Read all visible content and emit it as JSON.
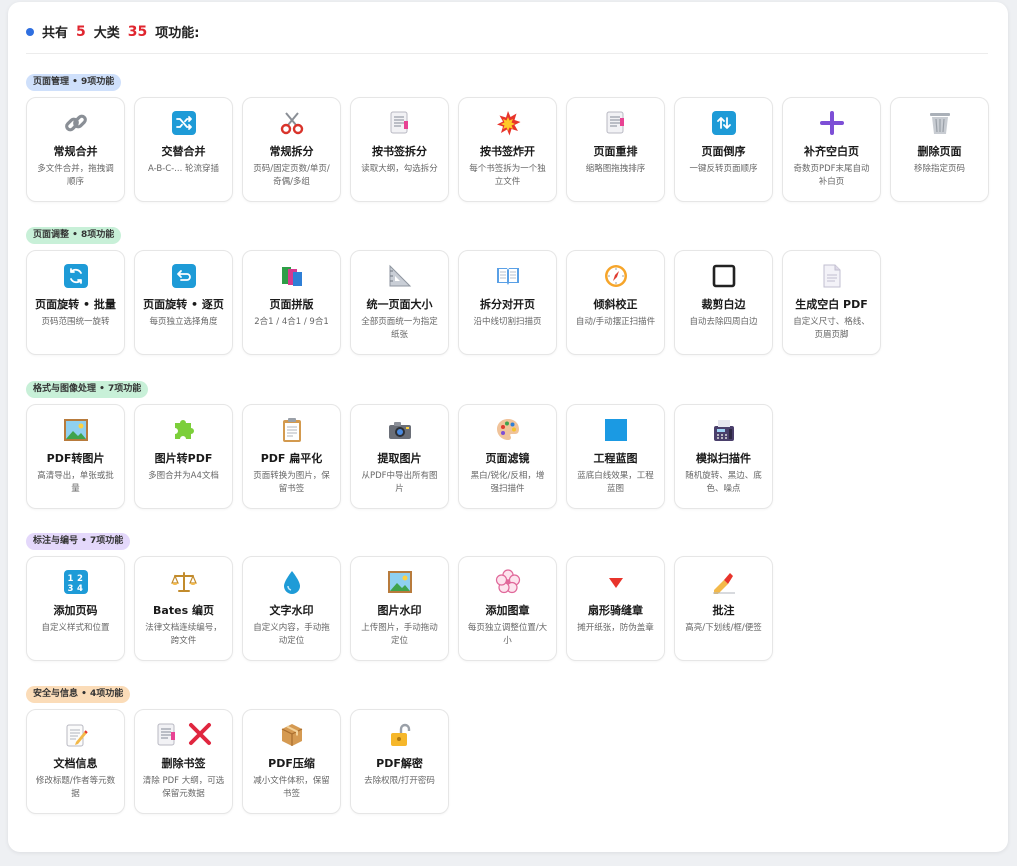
{
  "header": {
    "prefix": "共有",
    "big_count": "5",
    "mid": "大类",
    "func_count": "35",
    "suffix": "项功能:"
  },
  "sections": [
    {
      "badge": "页面管理 • 9项功能",
      "color": "#cfe0fb",
      "items": [
        {
          "title": "常规合并",
          "desc": "多文件合并，拖拽调顺序",
          "icon": "link-icon"
        },
        {
          "title": "交替合并",
          "desc": "A-B-C-... 轮流穿插",
          "icon": "shuffle-icon"
        },
        {
          "title": "常规拆分",
          "desc": "页码/固定页数/单页/奇偶/多组",
          "icon": "scissors-icon"
        },
        {
          "title": "按书签拆分",
          "desc": "读取大纲，勾选拆分",
          "icon": "bookmark-doc-icon"
        },
        {
          "title": "按书签炸开",
          "desc": "每个书签拆为一个独立文件",
          "icon": "explosion-icon"
        },
        {
          "title": "页面重排",
          "desc": "缩略图拖拽排序",
          "icon": "reorder-doc-icon"
        },
        {
          "title": "页面倒序",
          "desc": "一键反转页面顺序",
          "icon": "reverse-arrows-icon"
        },
        {
          "title": "补齐空白页",
          "desc": "奇数页PDF末尾自动补白页",
          "icon": "plus-icon"
        },
        {
          "title": "删除页面",
          "desc": "移除指定页码",
          "icon": "trash-icon"
        }
      ]
    },
    {
      "badge": "页面调整 • 8项功能",
      "color": "#c8f0d8",
      "items": [
        {
          "title": "页面旋转 • 批量",
          "desc": "页码范围统一旋转",
          "icon": "rotate-batch-icon"
        },
        {
          "title": "页面旋转 • 逐页",
          "desc": "每页独立选择角度",
          "icon": "rotate-page-icon"
        },
        {
          "title": "页面拼版",
          "desc": "2合1 / 4合1 / 9合1",
          "icon": "books-icon"
        },
        {
          "title": "统一页面大小",
          "desc": "全部页面统一为指定纸张",
          "icon": "triangle-ruler-icon"
        },
        {
          "title": "拆分对开页",
          "desc": "沿中线切割扫描页",
          "icon": "open-book-icon"
        },
        {
          "title": "倾斜校正",
          "desc": "自动/手动摆正扫描件",
          "icon": "compass-icon"
        },
        {
          "title": "裁剪白边",
          "desc": "自动去除四周白边",
          "icon": "crop-square-icon"
        },
        {
          "title": "生成空白 PDF",
          "desc": "自定义尺寸、格线、页眉页脚",
          "icon": "blank-doc-icon"
        }
      ]
    },
    {
      "badge": "格式与图像处理 • 7项功能",
      "color": "#c8f0d8",
      "items": [
        {
          "title": "PDF转图片",
          "desc": "高清导出，单张或批量",
          "icon": "picture-icon"
        },
        {
          "title": "图片转PDF",
          "desc": "多图合并为A4文档",
          "icon": "puzzle-icon"
        },
        {
          "title": "PDF 扁平化",
          "desc": "页面转换为图片，保留书签",
          "icon": "clipboard-icon"
        },
        {
          "title": "提取图片",
          "desc": "从PDF中导出所有图片",
          "icon": "camera-icon"
        },
        {
          "title": "页面滤镜",
          "desc": "黑白/锐化/反相，增强扫描件",
          "icon": "palette-icon"
        },
        {
          "title": "工程蓝图",
          "desc": "蓝底白线效果，工程蓝图",
          "icon": "blue-square-icon"
        },
        {
          "title": "模拟扫描件",
          "desc": "随机旋转、黑边、底色、噪点",
          "icon": "fax-icon"
        }
      ]
    },
    {
      "badge": "标注与编号 • 7项功能",
      "color": "#e4d8fb",
      "items": [
        {
          "title": "添加页码",
          "desc": "自定义样式和位置",
          "icon": "numbers-icon"
        },
        {
          "title": "Bates 编页",
          "desc": "法律文档连续编号，跨文件",
          "icon": "scales-icon"
        },
        {
          "title": "文字水印",
          "desc": "自定义内容，手动拖动定位",
          "icon": "droplet-icon"
        },
        {
          "title": "图片水印",
          "desc": "上传图片，手动拖动定位",
          "icon": "picture-frame-icon"
        },
        {
          "title": "添加图章",
          "desc": "每页独立调整位置/大小",
          "icon": "flower-stamp-icon"
        },
        {
          "title": "扇形骑缝章",
          "desc": "摊开纸张，防伪盖章",
          "icon": "red-triangle-icon"
        },
        {
          "title": "批注",
          "desc": "高亮/下划线/框/便签",
          "icon": "writing-hand-icon"
        }
      ]
    },
    {
      "badge": "安全与信息 • 4项功能",
      "color": "#fbdcb8",
      "items": [
        {
          "title": "文档信息",
          "desc": "修改标题/作者等元数据",
          "icon": "memo-icon"
        },
        {
          "title": "删除书签",
          "desc": "清除 PDF 大纲，可选保留元数据",
          "icon": "bookmark-delete-icon"
        },
        {
          "title": "PDF压缩",
          "desc": "减小文件体积，保留书签",
          "icon": "package-icon"
        },
        {
          "title": "PDF解密",
          "desc": "去除权限/打开密码",
          "icon": "unlock-icon"
        }
      ]
    }
  ]
}
